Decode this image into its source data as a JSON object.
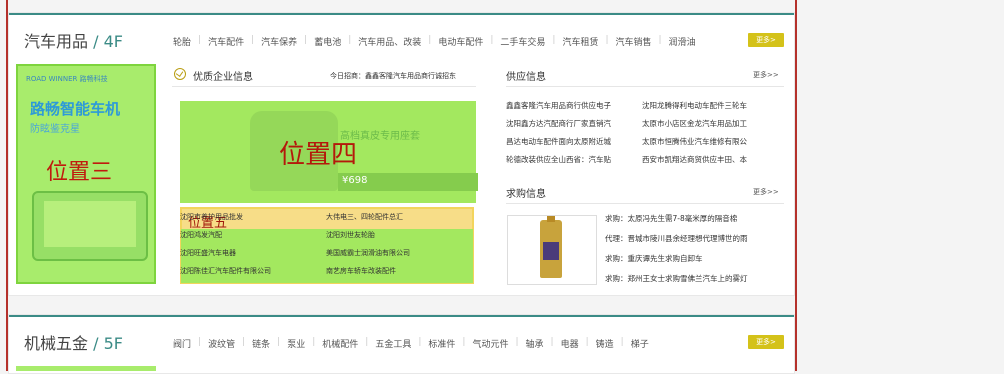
{
  "floor4": {
    "title": "汽车用品",
    "slash": "/",
    "num": "4F",
    "cats": [
      "轮胎",
      "汽车配件",
      "汽车保养",
      "蓄电池",
      "汽车用品、改装",
      "电动车配件",
      "二手车交易",
      "汽车租赁",
      "汽车销售",
      "润滑油"
    ],
    "more": "更多>",
    "banner": {
      "brand": "ROAD WINNER 路畅科技",
      "big": "路畅智能车机",
      "small": "防眩鉴克星",
      "pos3": "位置三"
    },
    "quality": {
      "title": "优质企业信息",
      "recruit": "今日招商：鑫鑫客隆汽车用品商行诚招东",
      "pos4": "位置四",
      "pos4_sub": "高档真皮专用座套",
      "price": "¥698"
    },
    "pos5": "位置五",
    "companies": [
      [
        "沈阳市养护用品批发",
        "大伟电三、四轮配件总汇"
      ],
      [
        "沈阳鸿发汽配",
        "沈阳刘世友轮胎"
      ],
      [
        "沈阳旺盛汽车电器",
        "美国威霸士润滑油有限公司"
      ],
      [
        "沈阳陈佳汇汽车配件有限公司",
        "南艺房车轿车改装配件"
      ]
    ],
    "supply": {
      "title": "供应信息",
      "more": "更多>>",
      "rows": [
        [
          "鑫鑫客隆汽车用品商行供应电子",
          "沈阳龙腾得利电动车配件三轮车"
        ],
        [
          "沈阳鑫方达汽配商行厂家直销汽",
          "太原市小店区金龙汽车用品加工"
        ],
        [
          "昌达电动车配件面向太原附近城",
          "太原市恒腾伟业汽车维修有限公"
        ],
        [
          "轮德改装供应全山西省：汽车贴",
          "西安市凯翔达商贸供应丰田、本"
        ]
      ]
    },
    "buy": {
      "title": "求购信息",
      "more": "更多>>",
      "rows": [
        "求购：太原冯先生需7-8毫米厚的隔音棉",
        "代理：晋城市陵川县余经理想代理博世的雨",
        "求购：重庆谭先生求购自卸车",
        "求购：郑州王女士求购雪佛兰汽车上的雾灯"
      ]
    }
  },
  "floor5": {
    "title": "机械五金",
    "slash": "/",
    "num": "5F",
    "cats": [
      "阀门",
      "波纹管",
      "链条",
      "泵业",
      "机械配件",
      "五金工具",
      "标准件",
      "气动元件",
      "轴承",
      "电器",
      "铸造",
      "梯子"
    ],
    "more": "更多>"
  }
}
